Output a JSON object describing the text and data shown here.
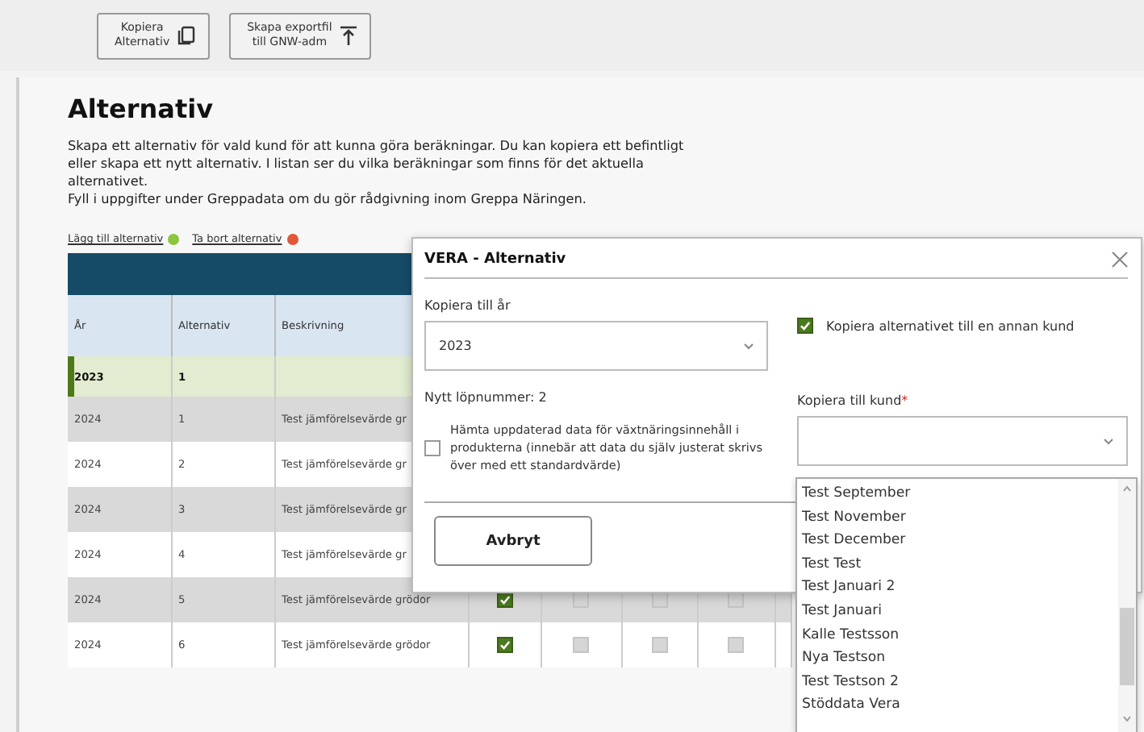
{
  "toolbar": {
    "buttons": [
      {
        "lines": [
          "Kopiera",
          "Alternativ"
        ],
        "kind": "copy"
      },
      {
        "lines": [
          "Skapa exportfil",
          "till GNW-adm"
        ],
        "kind": "export"
      }
    ]
  },
  "page": {
    "title": "Alternativ",
    "paragraphs": [
      "Skapa ett alternativ för vald kund för att kunna göra beräkningar. Du kan kopiera ett befintligt eller skapa ett nytt alternativ. I listan ser du vilka beräkningar som finns för det aktuella alternativet.",
      "Fyll i uppgifter under Greppadata om du gör rådgivning inom Greppa Näringen."
    ],
    "links": [
      {
        "label": "Lägg till alternativ",
        "kind": "add"
      },
      {
        "label": "Ta bort alternativ",
        "kind": "remove"
      }
    ]
  },
  "table": {
    "columns": [
      "År",
      "Alternativ",
      "Beskrivning"
    ],
    "rows": [
      {
        "year": "2023",
        "alternative": "1",
        "selected": true
      },
      {
        "year": "2024",
        "alternative": "1",
        "description": "Test jämförelsevärde gr",
        "selected": false
      },
      {
        "year": "2024",
        "alternative": "2",
        "description": "Test jämförelsevärde gr",
        "selected": false
      },
      {
        "year": "2024",
        "alternative": "3",
        "description": "Test jämförelsevärde gr",
        "selected": false
      },
      {
        "year": "2024",
        "alternative": "4",
        "description": "Test jämförelsevärde gr",
        "selected": false
      },
      {
        "year": "2024",
        "alternative": "5",
        "description": "Test jämförelsevärde grödor",
        "selected": false,
        "checks": [
          true,
          false,
          false,
          false
        ]
      },
      {
        "year": "2024",
        "alternative": "6",
        "description": "Test jämförelsevärde grödor",
        "selected": false,
        "checks": [
          true,
          false,
          false,
          false
        ]
      }
    ]
  },
  "dialog": {
    "title": "VERA - Alternativ",
    "year_field": {
      "label": "Kopiera till år",
      "value": "2023"
    },
    "new_number": {
      "label": "Nytt löpnummer:",
      "value": "2"
    },
    "update_checkbox": {
      "label": "Hämta uppdaterad data för växtnäringsinnehåll i produkterna (innebär att data du själv justerat skrivs över med ett standardvärde)",
      "checked": false
    },
    "other_customer_checkbox": {
      "label": "Kopiera alternativet till en annan kund",
      "checked": true
    },
    "customer_field": {
      "label": "Kopiera till kund",
      "required_mark": "*"
    },
    "cancel_button": "Avbryt"
  },
  "customer_list": {
    "items": [
      "Test September",
      "Test November",
      "Test December",
      "Test Test",
      "Test Januari 2",
      "Test Januari",
      "Kalle Testsson",
      "Nya Testson",
      "Test Testson 2",
      "Stöddata Vera"
    ]
  }
}
